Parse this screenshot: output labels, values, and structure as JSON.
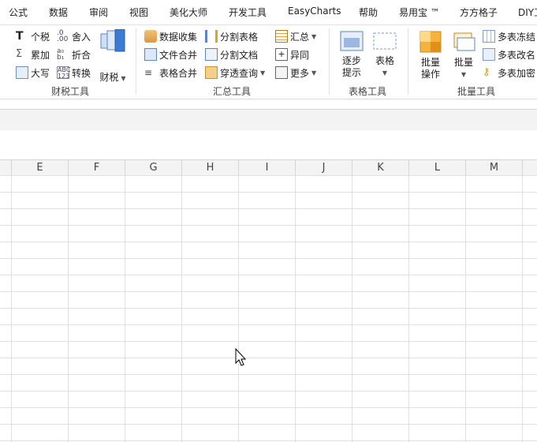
{
  "menu": [
    "公式",
    "数据",
    "审阅",
    "视图",
    "美化大师",
    "开发工具",
    "EasyCharts",
    "帮助",
    "易用宝 ™",
    "方方格子",
    "DIY工具"
  ],
  "groups": {
    "tax": {
      "label": "财税工具",
      "items": [
        "个税",
        "累加",
        "大写",
        "舍入",
        "折合",
        "转换"
      ],
      "big_label": "财税"
    },
    "summary": {
      "label": "汇总工具",
      "items": [
        "数据收集",
        "文件合并",
        "表格合并",
        "分割表格",
        "分割文档",
        "穿透查询",
        "汇总",
        "异同",
        "更多"
      ]
    },
    "table": {
      "label": "表格工具",
      "step_label_1": "逐步",
      "step_label_2": "提示",
      "table_label": "表格"
    },
    "batch": {
      "label": "批量工具",
      "op_label_1": "批量",
      "op_label_2": "操作",
      "batch_label": "批量",
      "items": [
        "多表冻结",
        "多表改名",
        "多表加密"
      ]
    }
  },
  "columns": [
    "E",
    "F",
    "G",
    "H",
    "I",
    "J",
    "K",
    "L",
    "M"
  ]
}
